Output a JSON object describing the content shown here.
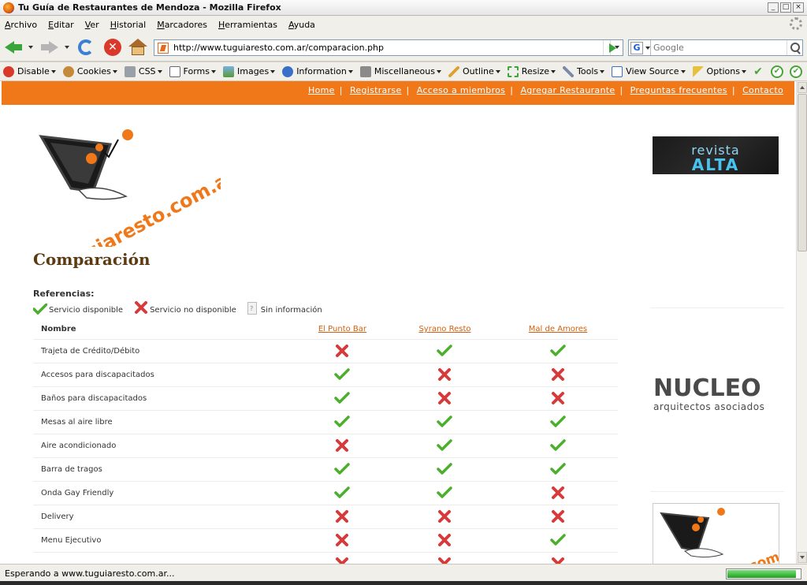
{
  "window": {
    "title": "Tu Guía de Restaurantes de Mendoza - Mozilla Firefox"
  },
  "menu": [
    "Archivo",
    "Editar",
    "Ver",
    "Historial",
    "Marcadores",
    "Herramientas",
    "Ayuda"
  ],
  "nav": {
    "url": "http://www.tuguiaresto.com.ar/comparacion.php",
    "search_placeholder": "Google",
    "search_engine": "G"
  },
  "devtools": [
    "Disable",
    "Cookies",
    "CSS",
    "Forms",
    "Images",
    "Information",
    "Miscellaneous",
    "Outline",
    "Resize",
    "Tools",
    "View Source",
    "Options"
  ],
  "site_nav": [
    "Home",
    "Registrarse",
    "Acceso a miembros",
    "Agregar Restaurante",
    "Preguntas frecuentes",
    "Contacto"
  ],
  "logo_text": "tuGuiaresto.com.ar",
  "page": {
    "title": "Comparación",
    "references_label": "Referencias:",
    "legend": {
      "available": "Servicio disponible",
      "unavailable": "Servicio no disponible",
      "no_info": "Sin información"
    }
  },
  "table": {
    "name_header": "Nombre",
    "restaurants": [
      "El Punto Bar",
      "Syrano Resto",
      "Mal de Amores"
    ],
    "rows": [
      {
        "name": "Trajeta de Crédito/Débito",
        "values": [
          "no",
          "yes",
          "yes"
        ]
      },
      {
        "name": "Accesos para discapacitados",
        "values": [
          "yes",
          "no",
          "no"
        ]
      },
      {
        "name": "Baños para discapacitados",
        "values": [
          "yes",
          "no",
          "no"
        ]
      },
      {
        "name": "Mesas al aire libre",
        "values": [
          "yes",
          "yes",
          "yes"
        ]
      },
      {
        "name": "Aire acondicionado",
        "values": [
          "no",
          "yes",
          "yes"
        ]
      },
      {
        "name": "Barra de tragos",
        "values": [
          "yes",
          "yes",
          "yes"
        ]
      },
      {
        "name": "Onda Gay Friendly",
        "values": [
          "yes",
          "yes",
          "no"
        ]
      },
      {
        "name": "Delivery",
        "values": [
          "no",
          "no",
          "no"
        ]
      },
      {
        "name": "Menu Ejecutivo",
        "values": [
          "no",
          "no",
          "yes"
        ]
      },
      {
        "name": "",
        "values": [
          "no",
          "no",
          "no"
        ]
      }
    ]
  },
  "sidebar": {
    "ad1": {
      "line1": "revista",
      "line2": "ALTA"
    },
    "ad2": {
      "line1": "NUCLEO",
      "line2": "arquitectos asociados"
    },
    "ad3_text": "tuGuiaresto.com.ar"
  },
  "status": {
    "text": "Esperando a www.tuguiaresto.com.ar...",
    "progress": 0.95
  },
  "colors": {
    "brand_orange": "#f07818",
    "title_brown": "#5c3a12",
    "link_orange": "#d06010",
    "check_green": "#4caf2c",
    "cross_red": "#d63a3a"
  }
}
